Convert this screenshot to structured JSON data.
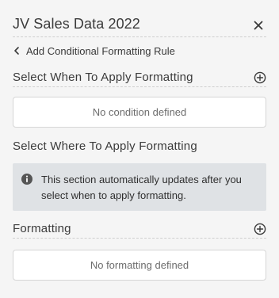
{
  "panel": {
    "title": "JV Sales Data 2022",
    "close_icon": "close-icon",
    "back_label": "Add Conditional Formatting Rule"
  },
  "sections": {
    "when": {
      "title": "Select When To Apply Formatting",
      "empty_text": "No condition defined"
    },
    "where": {
      "title": "Select Where To Apply Formatting",
      "info_text": "This section automatically updates after you select when to apply formatting."
    },
    "formatting": {
      "title": "Formatting",
      "empty_text": "No formatting defined"
    }
  },
  "colors": {
    "background": "#f5f5f5",
    "info_background": "#dfe2e5",
    "text": "#3b3b3b",
    "muted_text": "#6d6d6d"
  }
}
